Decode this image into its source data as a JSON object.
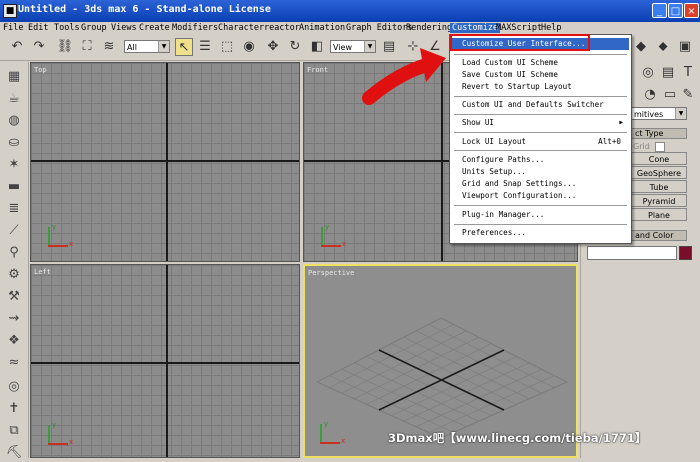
{
  "window": {
    "title": "Untitled - 3ds max 6 - Stand-alone License",
    "app_icon": "3ds-max-icon"
  },
  "menubar": {
    "items": [
      "File",
      "Edit",
      "Tools",
      "Group",
      "Views",
      "Create",
      "Modifiers",
      "Character",
      "reactor",
      "Animation",
      "Graph Editors",
      "Rendering",
      "Customize",
      "MAXScript",
      "Help"
    ],
    "active": "Customize"
  },
  "toolbar": {
    "selection_filter": "All",
    "reference_coord": "View"
  },
  "viewports": {
    "top": "Top",
    "front": "Front",
    "left": "Left",
    "perspective": "Perspective"
  },
  "command_panel": {
    "dropdown": "mitives",
    "object_type_header": "ct Type",
    "autogrid": "Grid",
    "buttons": [
      "Cone",
      "GeoSphere",
      "Tube",
      "Pyramid",
      "Plane"
    ],
    "name_color_header": "and Color",
    "accent_color": "#7a0e2a"
  },
  "customize_menu": {
    "items": [
      {
        "label": "Customize User Interface...",
        "highlighted": true
      },
      {
        "label": "Load Custom UI Scheme"
      },
      {
        "label": "Save Custom UI Scheme"
      },
      {
        "label": "Revert to Startup Layout"
      },
      {
        "label": "Custom UI and Defaults Switcher"
      },
      {
        "label": "Show UI",
        "submenu": true
      },
      {
        "label": "Lock UI Layout",
        "shortcut": "Alt+0"
      },
      {
        "label": "Configure Paths..."
      },
      {
        "label": "Units Setup..."
      },
      {
        "label": "Grid and Snap Settings..."
      },
      {
        "label": "Viewport Configuration..."
      },
      {
        "label": "Plug-in Manager..."
      },
      {
        "label": "Preferences..."
      }
    ]
  },
  "axis_labels": {
    "x": "x",
    "y": "y"
  },
  "watermark": "3Dmax吧【www.linecg.com/tieba/1771】",
  "colors": {
    "title_bar": "#0a3fb2",
    "menu_highlight": "#3167c6",
    "annotation": "#e01010",
    "active_viewport": "#f0e060"
  }
}
